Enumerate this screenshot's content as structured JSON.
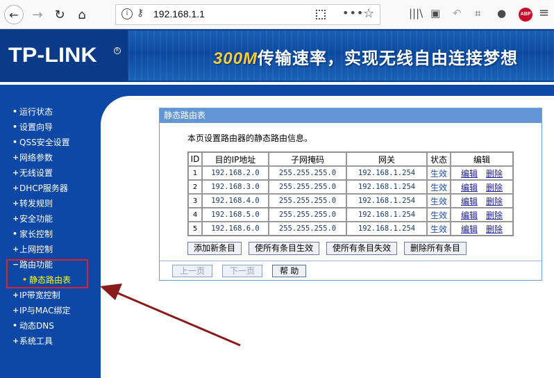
{
  "browser": {
    "url": "192.168.1.1",
    "info_glyph": "i",
    "abp_label": "ABP"
  },
  "header": {
    "logo": "TP-LINK",
    "logo_reg": "R",
    "banner_speed": "300M",
    "banner_slogan": "传输速率，实现无线自由连接梦想"
  },
  "sidebar": {
    "items": [
      {
        "mark": "•",
        "label": "运行状态"
      },
      {
        "mark": "•",
        "label": "设置向导"
      },
      {
        "mark": "•",
        "label": "QSS安全设置"
      },
      {
        "mark": "+",
        "label": "网络参数"
      },
      {
        "mark": "+",
        "label": "无线设置"
      },
      {
        "mark": "+",
        "label": "DHCP服务器"
      },
      {
        "mark": "+",
        "label": "转发规则"
      },
      {
        "mark": "+",
        "label": "安全功能"
      },
      {
        "mark": "•",
        "label": "家长控制"
      },
      {
        "mark": "+",
        "label": "上网控制"
      },
      {
        "mark": "−",
        "label": "路由功能"
      },
      {
        "mark": "•",
        "label": "静态路由表"
      },
      {
        "mark": "+",
        "label": "IP带宽控制"
      },
      {
        "mark": "+",
        "label": "IP与MAC绑定"
      },
      {
        "mark": "•",
        "label": "动态DNS"
      },
      {
        "mark": "+",
        "label": "系统工具"
      }
    ]
  },
  "panel": {
    "title": "静态路由表",
    "description": "本页设置路由器的静态路由信息。",
    "columns": [
      "ID",
      "目的IP地址",
      "子网掩码",
      "网关",
      "状态",
      "编辑"
    ],
    "rows": [
      {
        "id": "1",
        "dest": "192.168.2.0",
        "mask": "255.255.255.0",
        "gateway": "192.168.1.254",
        "status": "生效",
        "edit": "编辑",
        "delete": "删除"
      },
      {
        "id": "2",
        "dest": "192.168.3.0",
        "mask": "255.255.255.0",
        "gateway": "192.168.1.254",
        "status": "生效",
        "edit": "编辑",
        "delete": "删除"
      },
      {
        "id": "3",
        "dest": "192.168.4.0",
        "mask": "255.255.255.0",
        "gateway": "192.168.1.254",
        "status": "生效",
        "edit": "编辑",
        "delete": "删除"
      },
      {
        "id": "4",
        "dest": "192.168.5.0",
        "mask": "255.255.255.0",
        "gateway": "192.168.1.254",
        "status": "生效",
        "edit": "编辑",
        "delete": "删除"
      },
      {
        "id": "5",
        "dest": "192.168.6.0",
        "mask": "255.255.255.0",
        "gateway": "192.168.1.254",
        "status": "生效",
        "edit": "编辑",
        "delete": "删除"
      }
    ],
    "buttons": {
      "add": "添加新条目",
      "enable_all": "使所有条目生效",
      "disable_all": "使所有条目失效",
      "delete_all": "删除所有条目"
    },
    "footer": {
      "prev": "上一页",
      "next": "下一页",
      "help": "帮 助"
    }
  },
  "colors": {
    "sidebar_bg": "#0e48a6",
    "panel_title_bg": "#6496d6",
    "highlight": "#e0202a",
    "annotation_arrow": "#8b1a1a"
  }
}
